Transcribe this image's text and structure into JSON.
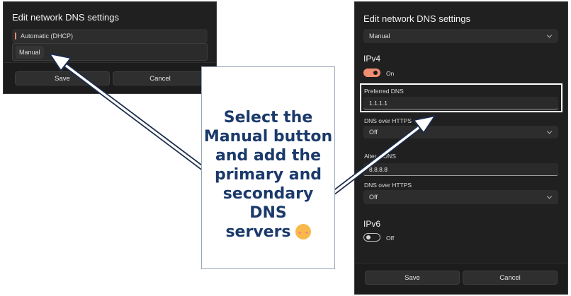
{
  "left_dialog": {
    "title": "Edit network DNS settings",
    "dropdown_value": "Automatic (DHCP)",
    "menu_option": "Manual",
    "save_label": "Save",
    "cancel_label": "Cancel"
  },
  "right_dialog": {
    "title": "Edit network DNS settings",
    "mode_value": "Manual",
    "ipv4_heading": "IPv4",
    "ipv4_toggle_label": "On",
    "ipv4_toggle_on": true,
    "preferred_dns_label": "Preferred DNS",
    "preferred_dns_value": "1.1.1.1",
    "doh1_label": "DNS over HTTPS",
    "doh1_value": "Off",
    "alternate_dns_label": "Alter    DNS",
    "alternate_dns_value": "8.8.8.8",
    "doh2_label": "DNS over HTTPS",
    "doh2_value": "Off",
    "ipv6_heading": "IPv6",
    "ipv6_toggle_label": "Off",
    "ipv6_toggle_on": false,
    "save_label": "Save",
    "cancel_label": "Cancel"
  },
  "callout": {
    "lines": [
      "Select the",
      "Manual button",
      "and add the",
      "primary and",
      "secondary DNS",
      "servers"
    ],
    "emoji": "kissing-face-with-closed-eyes"
  },
  "colors": {
    "dialog_bg": "#202020",
    "accent_toggle": "#f08d72",
    "callout_text": "#1b3a6b",
    "highlight_box": "#ffffff"
  }
}
